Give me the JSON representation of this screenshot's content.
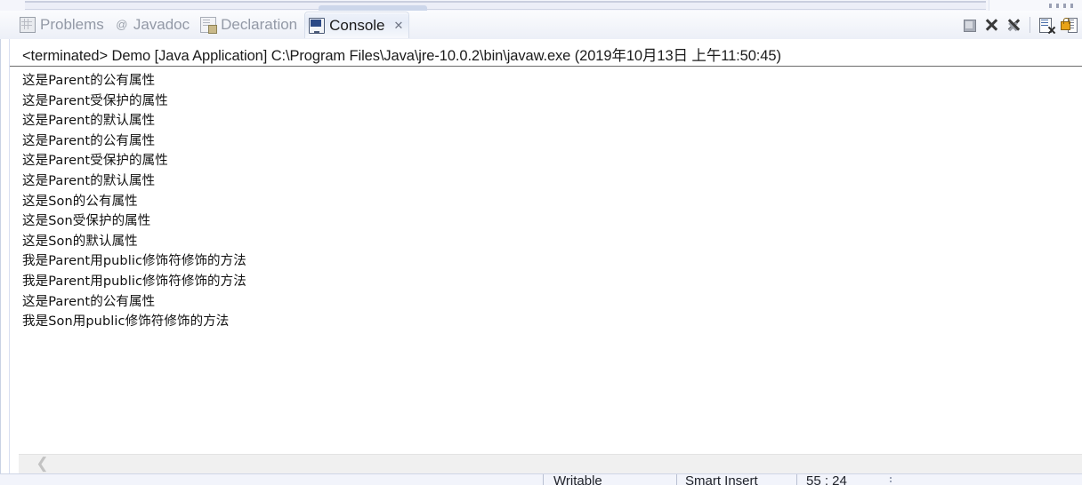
{
  "window": {
    "view_name": "Console"
  },
  "tabs": [
    {
      "label": "Problems",
      "icon": "problems-icon",
      "active": false,
      "closable": false
    },
    {
      "label": "Javadoc",
      "icon": "javadoc-icon",
      "active": false,
      "closable": false
    },
    {
      "label": "Declaration",
      "icon": "declaration-icon",
      "active": false,
      "closable": false
    },
    {
      "label": "Console",
      "icon": "console-icon",
      "active": true,
      "closable": true,
      "close_glyph": "✕"
    }
  ],
  "toolbar": {
    "buttons": [
      {
        "name": "terminate-button",
        "icon": "stop-square-icon",
        "tooltip": "Terminate"
      },
      {
        "name": "remove-launch-button",
        "icon": "close-x-icon",
        "tooltip": "Remove Launch"
      },
      {
        "name": "remove-all-launches-button",
        "icon": "close-all-x-icon",
        "tooltip": "Remove All Terminated Launches"
      },
      {
        "name": "clear-console-button",
        "icon": "clear-console-icon",
        "tooltip": "Clear Console"
      },
      {
        "name": "scroll-lock-button",
        "icon": "scroll-lock-icon",
        "tooltip": "Scroll Lock"
      }
    ]
  },
  "console": {
    "process_header": "<terminated> Demo [Java Application] C:\\Program Files\\Java\\jre-10.0.2\\bin\\javaw.exe (2019年10月13日 上午11:50:45)",
    "output": [
      "这是Parent的公有属性",
      "这是Parent受保护的属性",
      "这是Parent的默认属性",
      "这是Parent的公有属性",
      "这是Parent受保护的属性",
      "这是Parent的默认属性",
      "这是Son的公有属性",
      "这是Son受保护的属性",
      "这是Son的默认属性",
      "我是Parent用public修饰符修饰的方法",
      "我是Parent用public修饰符修饰的方法",
      "这是Parent的公有属性",
      "我是Son用public修饰符修饰的方法"
    ],
    "scroll_left_glyph": "❮"
  },
  "status_bar": {
    "writable": "Writable",
    "insert_mode": "Smart Insert",
    "cursor_position": "55 : 24"
  },
  "colors": {
    "tab_strip_bg": "#f3f5fa",
    "active_tab_bg": "#e9eef8",
    "console_bg": "#ffffff",
    "text": "#111111",
    "inactive_tab_text": "#9399a6",
    "status_bar_bg": "#f2f4fb"
  }
}
